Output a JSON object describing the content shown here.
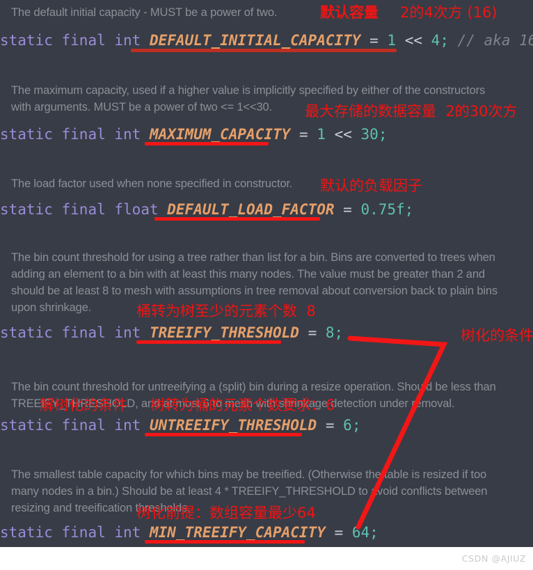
{
  "meta": {
    "background_dark": "#383c46",
    "background_page": "#ffffff",
    "comment_color": "#8c8f96",
    "keyword_color": "#9a8cd8",
    "identifier_color": "#e5a06a",
    "number_color": "#5fc0b0",
    "operator_color": "#c9ccd3",
    "annotation_red": "#f01414",
    "underline_dark_red": "#bd2f21",
    "underline_bright_red": "#f21616"
  },
  "watermark": "CSDN @AJIUZ",
  "blocks": [
    {
      "id": "default-initial-capacity",
      "doc": "The default initial capacity - MUST be a power of two.",
      "code": {
        "kw1": "static",
        "kw2": "final",
        "type": "int",
        "name": "DEFAULT_INITIAL_CAPACITY",
        "eq": "=",
        "value": "1",
        "shift": "<<",
        "operand": "4",
        "semi": ";",
        "comment": "// aka 16"
      },
      "annotations": [
        {
          "text": "默认容量",
          "bold": true
        },
        {
          "text": "2的4次方 (16)",
          "bold": false
        }
      ]
    },
    {
      "id": "maximum-capacity",
      "doc": "The maximum capacity, used if a higher value is implicitly specified by either of the constructors\nwith arguments. MUST be a power of two <= 1<<30.",
      "code": {
        "kw1": "static",
        "kw2": "final",
        "type": "int",
        "name": "MAXIMUM_CAPACITY",
        "eq": "=",
        "value": "1",
        "shift": "<<",
        "operand": "30",
        "semi": ";",
        "comment": ""
      },
      "annotations": [
        {
          "text": "最大存储的数据容量  2的30次方",
          "bold": false
        }
      ]
    },
    {
      "id": "default-load-factor",
      "doc": "The load factor used when none specified in constructor.",
      "code": {
        "kw1": "static",
        "kw2": "final",
        "type": "float",
        "name": "DEFAULT_LOAD_FACTOR",
        "eq": "=",
        "value": "0.75f",
        "shift": "",
        "operand": "",
        "semi": ";",
        "comment": ""
      },
      "annotations": [
        {
          "text": "默认的负载因子",
          "bold": false
        }
      ]
    },
    {
      "id": "treeify-threshold",
      "doc": "The bin count threshold for using a tree rather than list for a bin. Bins are converted to trees when\nadding an element to a bin with at least this many nodes. The value must be greater than 2 and\nshould be at least 8 to mesh with assumptions in tree removal about conversion back to plain bins\nupon shrinkage.",
      "code": {
        "kw1": "static",
        "kw2": "final",
        "type": "int",
        "name": "TREEIFY_THRESHOLD",
        "eq": "=",
        "value": "8",
        "shift": "",
        "operand": "",
        "semi": ";",
        "comment": ""
      },
      "annotations": [
        {
          "text": "桶转为树至少的元素个数  8",
          "bold": false
        },
        {
          "text": "树化的条件",
          "bold": false
        }
      ]
    },
    {
      "id": "untreeify-threshold",
      "doc": "The bin count threshold for untreeifying a (split) bin during a resize operation. Should be less than\nTREEIFY_THRESHOLD, and at most 6 to mesh with shrinkage detection under removal.",
      "code": {
        "kw1": "static",
        "kw2": "final",
        "type": "int",
        "name": "UNTREEIFY_THRESHOLD",
        "eq": "=",
        "value": "6",
        "shift": "",
        "operand": "",
        "semi": ";",
        "comment": ""
      },
      "annotations": [
        {
          "text": "解树化的条件",
          "bold": false
        },
        {
          "text": "树转为桶的元素个数要求：6",
          "bold": false
        }
      ]
    },
    {
      "id": "min-treeify-capacity",
      "doc": "The smallest table capacity for which bins may be treeified. (Otherwise the table is resized if too\nmany nodes in a bin.) Should be at least 4 * TREEIFY_THRESHOLD to avoid conflicts between\nresizing and treeification thresholds.",
      "code": {
        "kw1": "static",
        "kw2": "final",
        "type": "int",
        "name": "MIN_TREEIFY_CAPACITY",
        "eq": "=",
        "value": "64",
        "shift": "",
        "operand": "",
        "semi": ";",
        "comment": ""
      },
      "annotations": [
        {
          "text": "树化前提：数组容量最少64",
          "bold": false
        }
      ]
    }
  ]
}
